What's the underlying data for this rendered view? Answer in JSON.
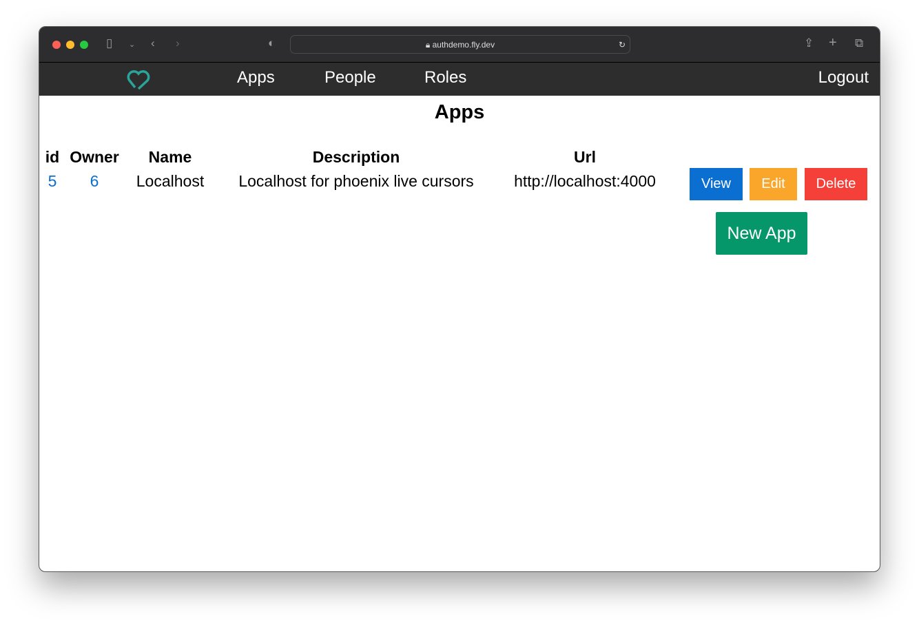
{
  "browser": {
    "url": "authdemo.fly.dev"
  },
  "nav": {
    "items": [
      "Apps",
      "People",
      "Roles"
    ],
    "logout": "Logout"
  },
  "page": {
    "title": "Apps"
  },
  "table": {
    "headers": [
      "id",
      "Owner",
      "Name",
      "Description",
      "Url"
    ],
    "rows": [
      {
        "id": "5",
        "owner": "6",
        "name": "Localhost",
        "description": "Localhost for phoenix live cursors",
        "url": "http://localhost:4000"
      }
    ]
  },
  "actions": {
    "view": "View",
    "edit": "Edit",
    "delete": "Delete",
    "new": "New App"
  },
  "colors": {
    "view": "#0a6fd0",
    "edit": "#f9a62b",
    "delete": "#f5403a",
    "new": "#059669",
    "logo": "#2aa39a"
  }
}
